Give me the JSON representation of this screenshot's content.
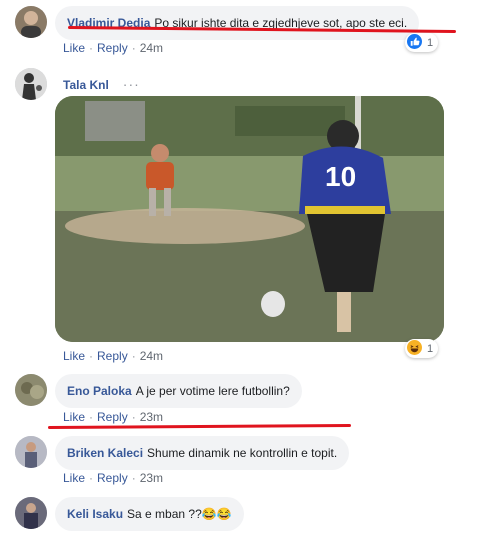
{
  "comments": [
    {
      "author": "Vladimir Dedja",
      "text": "Po sikur ishte dita e zgjedhjeve sot, apo ste eci.",
      "like": "Like",
      "reply": "Reply",
      "time": "24m",
      "reaction_count": "1"
    },
    {
      "author": "Tala Knl",
      "like": "Like",
      "reply": "Reply",
      "time": "24m",
      "reaction_count": "1",
      "more": "···"
    },
    {
      "author": "Eno Paloka",
      "text": "A je per votime lere futbollin?",
      "like": "Like",
      "reply": "Reply",
      "time": "23m"
    },
    {
      "author": "Briken Kaleci",
      "text": "Shume dinamik ne kontrollin e topit.",
      "like": "Like",
      "reply": "Reply",
      "time": "23m"
    },
    {
      "author": "Keli Isaku",
      "text": "Sa e mban ??😂😂"
    }
  ],
  "gif": {
    "jersey_number": "10"
  },
  "colors": {
    "link": "#385898",
    "bubble": "#f2f3f5",
    "annotation": "#e0141e"
  }
}
